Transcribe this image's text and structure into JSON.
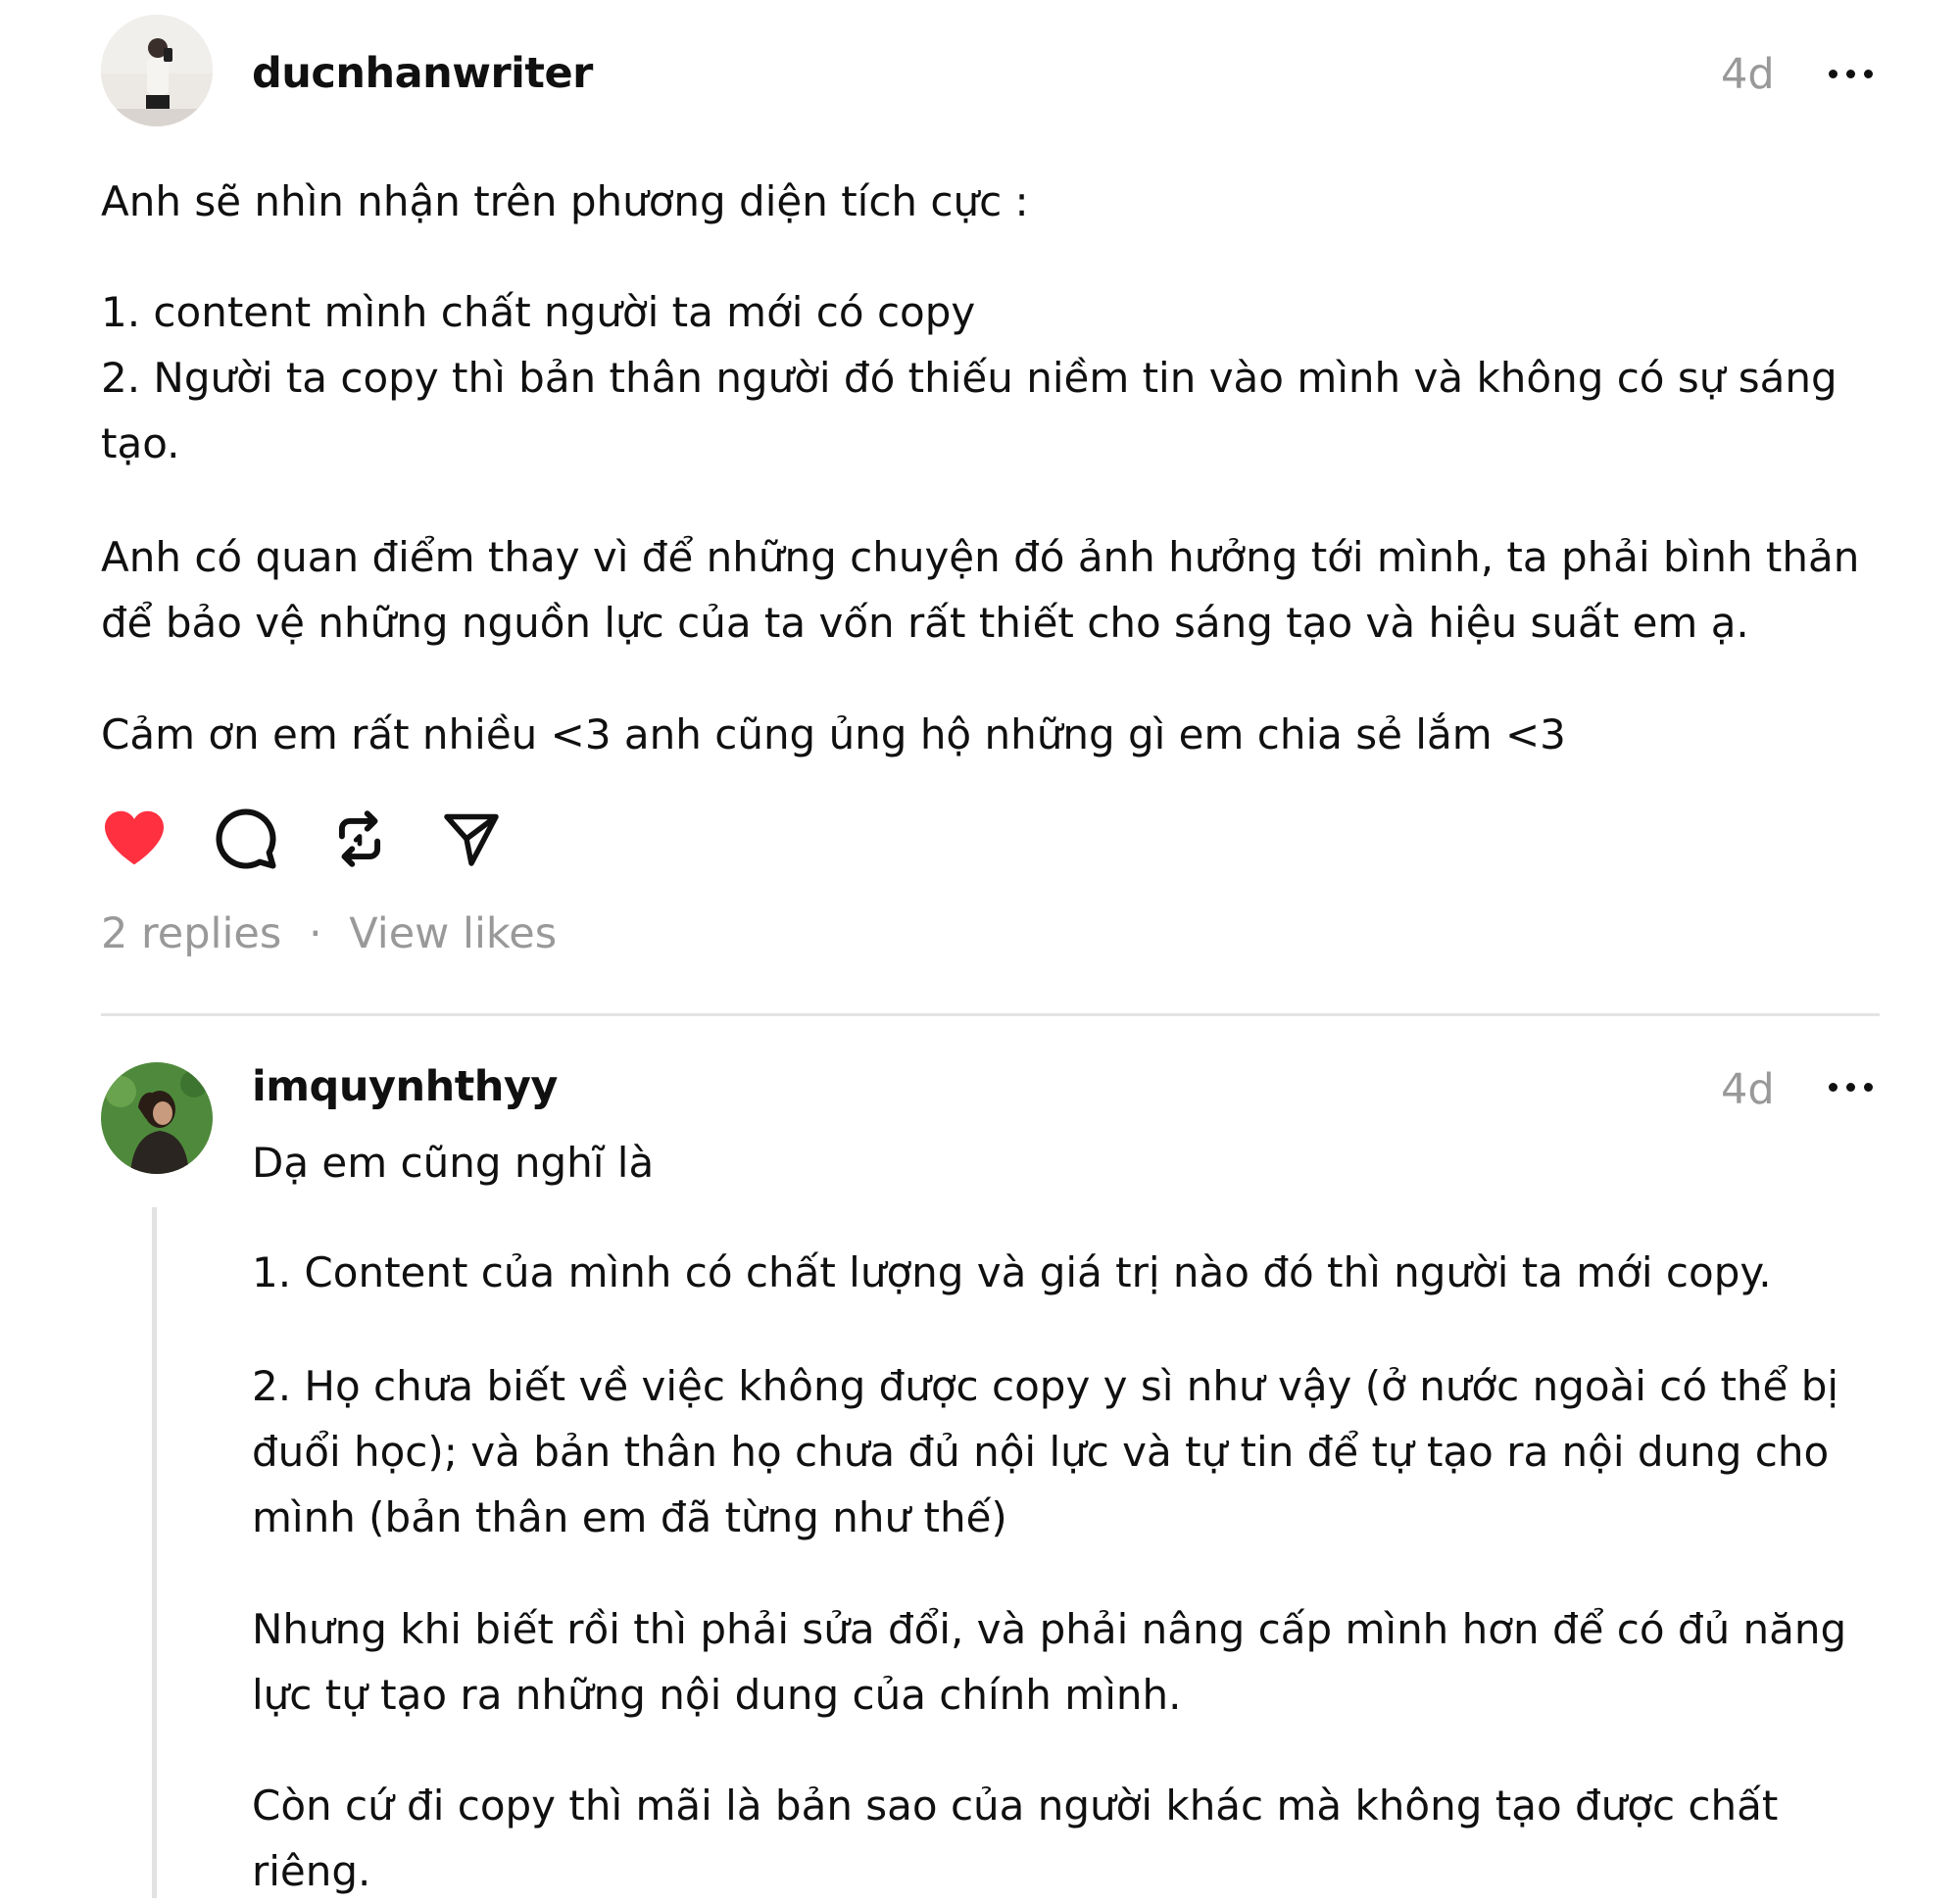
{
  "post": {
    "username": "ducnhanwriter",
    "time": "4d",
    "paragraphs": [
      "Anh sẽ nhìn nhận trên phương diện tích cực :",
      "1. content mình chất người ta mới có copy",
      "2. Người ta copy thì bản thân người đó thiếu niềm tin vào mình và không có sự sáng",
      "tạo.",
      "Anh có quan điểm thay vì để những chuyện đó ảnh hưởng tới mình, ta phải bình thản",
      "để bảo vệ những nguồn lực của ta vốn rất thiết cho sáng tạo và hiệu suất em ạ.",
      "Cảm ơn em rất nhiều <3 anh cũng ủng hộ những gì em chia sẻ lắm <3"
    ],
    "actions": {
      "like_icon": "heart-icon",
      "comment_icon": "comment-icon",
      "repost_icon": "repost-icon",
      "share_icon": "share-icon",
      "like_color": "#ff3040"
    },
    "replies_label": "2 replies",
    "separator": "·",
    "view_likes_label": "View likes"
  },
  "reply": {
    "username": "imquynhthyy",
    "time": "4d",
    "paragraphs": [
      "Dạ em cũng nghĩ là",
      "1. Content của mình có chất lượng và giá trị nào đó thì người ta mới copy.",
      "2. Họ chưa biết về việc không được copy y sì như vậy (ở nước ngoài có thể bị",
      "đuổi học); và bản thân họ chưa đủ nội lực và tự tin để tự tạo ra nội dung cho",
      "mình (bản thân em đã từng như thế)",
      "Nhưng khi biết rồi thì phải sửa đổi, và phải nâng cấp mình hơn để có đủ năng",
      "lực tự tạo ra những nội dung của chính mình.",
      "Còn cứ đi copy thì mãi là bản sao của người khác mà không tạo được chất",
      "riêng."
    ]
  }
}
